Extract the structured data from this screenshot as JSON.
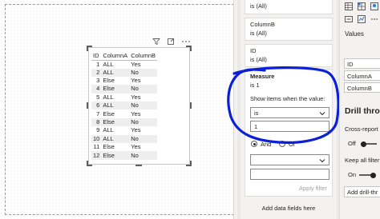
{
  "table": {
    "headers": [
      "ID",
      "ColumnA",
      "ColumnB"
    ],
    "rows": [
      [
        "1",
        "ALL",
        "Yes"
      ],
      [
        "2",
        "ALL",
        "No"
      ],
      [
        "3",
        "Else",
        "Yes"
      ],
      [
        "4",
        "Else",
        "No"
      ],
      [
        "5",
        "ALL",
        "Yes"
      ],
      [
        "6",
        "ALL",
        "No"
      ],
      [
        "7",
        "Else",
        "Yes"
      ],
      [
        "8",
        "Else",
        "No"
      ],
      [
        "9",
        "ALL",
        "Yes"
      ],
      [
        "10",
        "ALL",
        "No"
      ],
      [
        "11",
        "Else",
        "Yes"
      ],
      [
        "12",
        "Else",
        "No"
      ]
    ]
  },
  "filters": {
    "top_card_value": "is (All)",
    "columnB": {
      "title": "ColumnB",
      "value": "is (All)"
    },
    "id": {
      "title": "ID",
      "value": "is (All)"
    },
    "measure": {
      "title": "Measure",
      "value": "is 1",
      "show_items_label": "Show items when the value:",
      "operator": "is",
      "operand": "1",
      "and_label": "And",
      "or_label": "Or",
      "apply_label": "Apply filter"
    },
    "add_data_fields": "Add data fields here"
  },
  "viz": {
    "values_label": "Values",
    "fields": [
      "ID",
      "ColumnA",
      "ColumnB"
    ],
    "drill_title": "Drill thro",
    "cross_report_label": "Cross-report",
    "off_label": "Off",
    "keep_filters_label": "Keep all filter",
    "on_label": "On",
    "add_drill_label": "Add drill-thr"
  },
  "colors": {
    "annotation": "#0a1fd6",
    "canvas": "#ffffff",
    "pane": "#f3f2f1"
  },
  "icons": [
    "filter-icon",
    "focus-mode-icon",
    "more-options-icon",
    "chevron-down-icon",
    "visual-table-icon",
    "visual-matrix-icon",
    "visual-map-icon",
    "visual-card-icon"
  ]
}
